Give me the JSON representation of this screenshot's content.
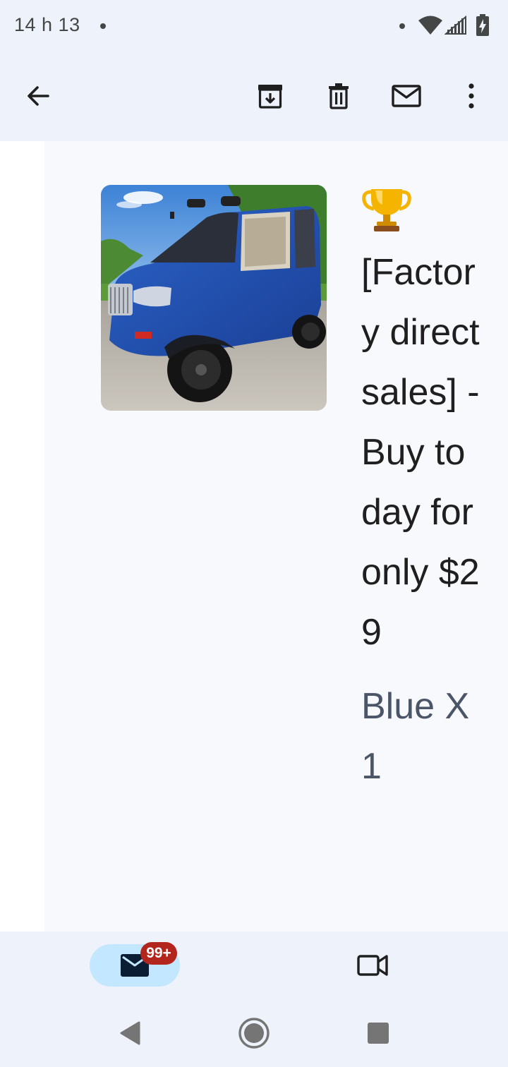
{
  "status_bar": {
    "time": "14 h 13"
  },
  "message": {
    "trophy_icon": "trophy-emoji",
    "headline": "[Factory direct sales] -Buy today for only $29",
    "variant": "Blue X 1",
    "image_icon": "blue-electric-microcar-photo"
  },
  "bottom_nav": {
    "mail_badge": "99+"
  },
  "colors": {
    "background": "#eef2fa",
    "panel": "#f8f9fc",
    "active_nav": "#c2e7ff",
    "badge": "#b3261e",
    "icon": "#1f1f1f"
  }
}
